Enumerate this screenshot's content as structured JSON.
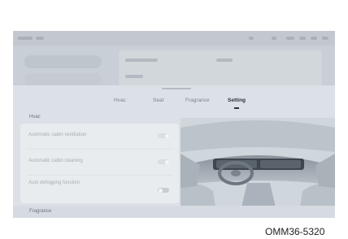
{
  "tabs": [
    {
      "label": "Hvac",
      "active": false
    },
    {
      "label": "Seat",
      "active": false
    },
    {
      "label": "Fragrance",
      "active": false
    },
    {
      "label": "Setting",
      "active": true
    }
  ],
  "sections": {
    "hvac_title": "Hvac",
    "fragrance_title": "Fragrance"
  },
  "settings": [
    {
      "label": "Automatic cabin ventilation",
      "toggle": "on"
    },
    {
      "label": "Automatic cabin cleaning",
      "toggle": "on"
    },
    {
      "label": "Auto defogging function",
      "description": "",
      "toggle": "off"
    }
  ],
  "image_code": "OMM36-5320",
  "colors": {
    "accent": "#2d3339",
    "sheet": "#dbe1e6",
    "card": "#e8ecef"
  }
}
